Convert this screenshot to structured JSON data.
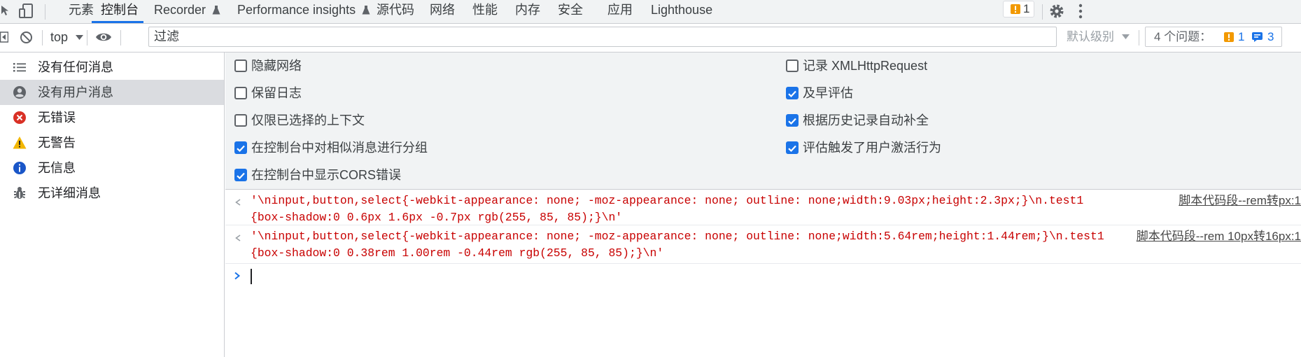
{
  "tabbar": {
    "tabs": [
      "元素",
      "控制台",
      "Recorder",
      "Performance insights",
      "源代码",
      "网络",
      "性能",
      "内存",
      "安全",
      "应用",
      "Lighthouse"
    ],
    "active_tab": "控制台",
    "issues_badge_count": "1"
  },
  "toolbar": {
    "context_select": "top",
    "filter_placeholder": "过滤",
    "level_select": "默认级别",
    "issues_label": "4 个问题：",
    "issues_warning_count": "1",
    "issues_info_count": "3"
  },
  "sidebar": {
    "items": [
      {
        "label": "没有任何消息",
        "icon": "list-icon"
      },
      {
        "label": "没有用户消息",
        "icon": "user-icon",
        "selected": true
      },
      {
        "label": "无错误",
        "icon": "error-icon"
      },
      {
        "label": "无警告",
        "icon": "warning-icon"
      },
      {
        "label": "无信息",
        "icon": "info-icon"
      },
      {
        "label": "无详细消息",
        "icon": "bug-icon"
      }
    ]
  },
  "settings": {
    "left": [
      {
        "label": "隐藏网络",
        "checked": false
      },
      {
        "label": "保留日志",
        "checked": false
      },
      {
        "label": "仅限已选择的上下文",
        "checked": false
      },
      {
        "label": "在控制台中对相似消息进行分组",
        "checked": true
      },
      {
        "label": "在控制台中显示CORS错误",
        "checked": true
      }
    ],
    "right": [
      {
        "label": "记录 XMLHttpRequest",
        "checked": false
      },
      {
        "label": "及早评估",
        "checked": true
      },
      {
        "label": "根据历史记录自动补全",
        "checked": true
      },
      {
        "label": "评估触发了用户激活行为",
        "checked": true
      }
    ]
  },
  "console": {
    "messages": [
      {
        "text": "'\\ninput,button,select{-webkit-appearance: none; -moz-appearance: none; outline: none;width:9.03px;height:2.3px;}\\n.test1 {box-shadow:0 0.6px 1.6px -0.7px rgb(255, 85, 85);}\\n'",
        "source": "脚本代码段--rem转px:1"
      },
      {
        "text": "'\\ninput,button,select{-webkit-appearance: none; -moz-appearance: none; outline: none;width:5.64rem;height:1.44rem;}\\n.test1 {box-shadow:0 0.38rem 1.00rem -0.44rem rgb(255, 85, 85);}\\n'",
        "source": "脚本代码段--rem 10px转16px:1"
      }
    ]
  },
  "colors": {
    "accent": "#1a73e8",
    "error_text": "#c80000",
    "warning": "#f29900",
    "error_icon": "#d93025"
  }
}
